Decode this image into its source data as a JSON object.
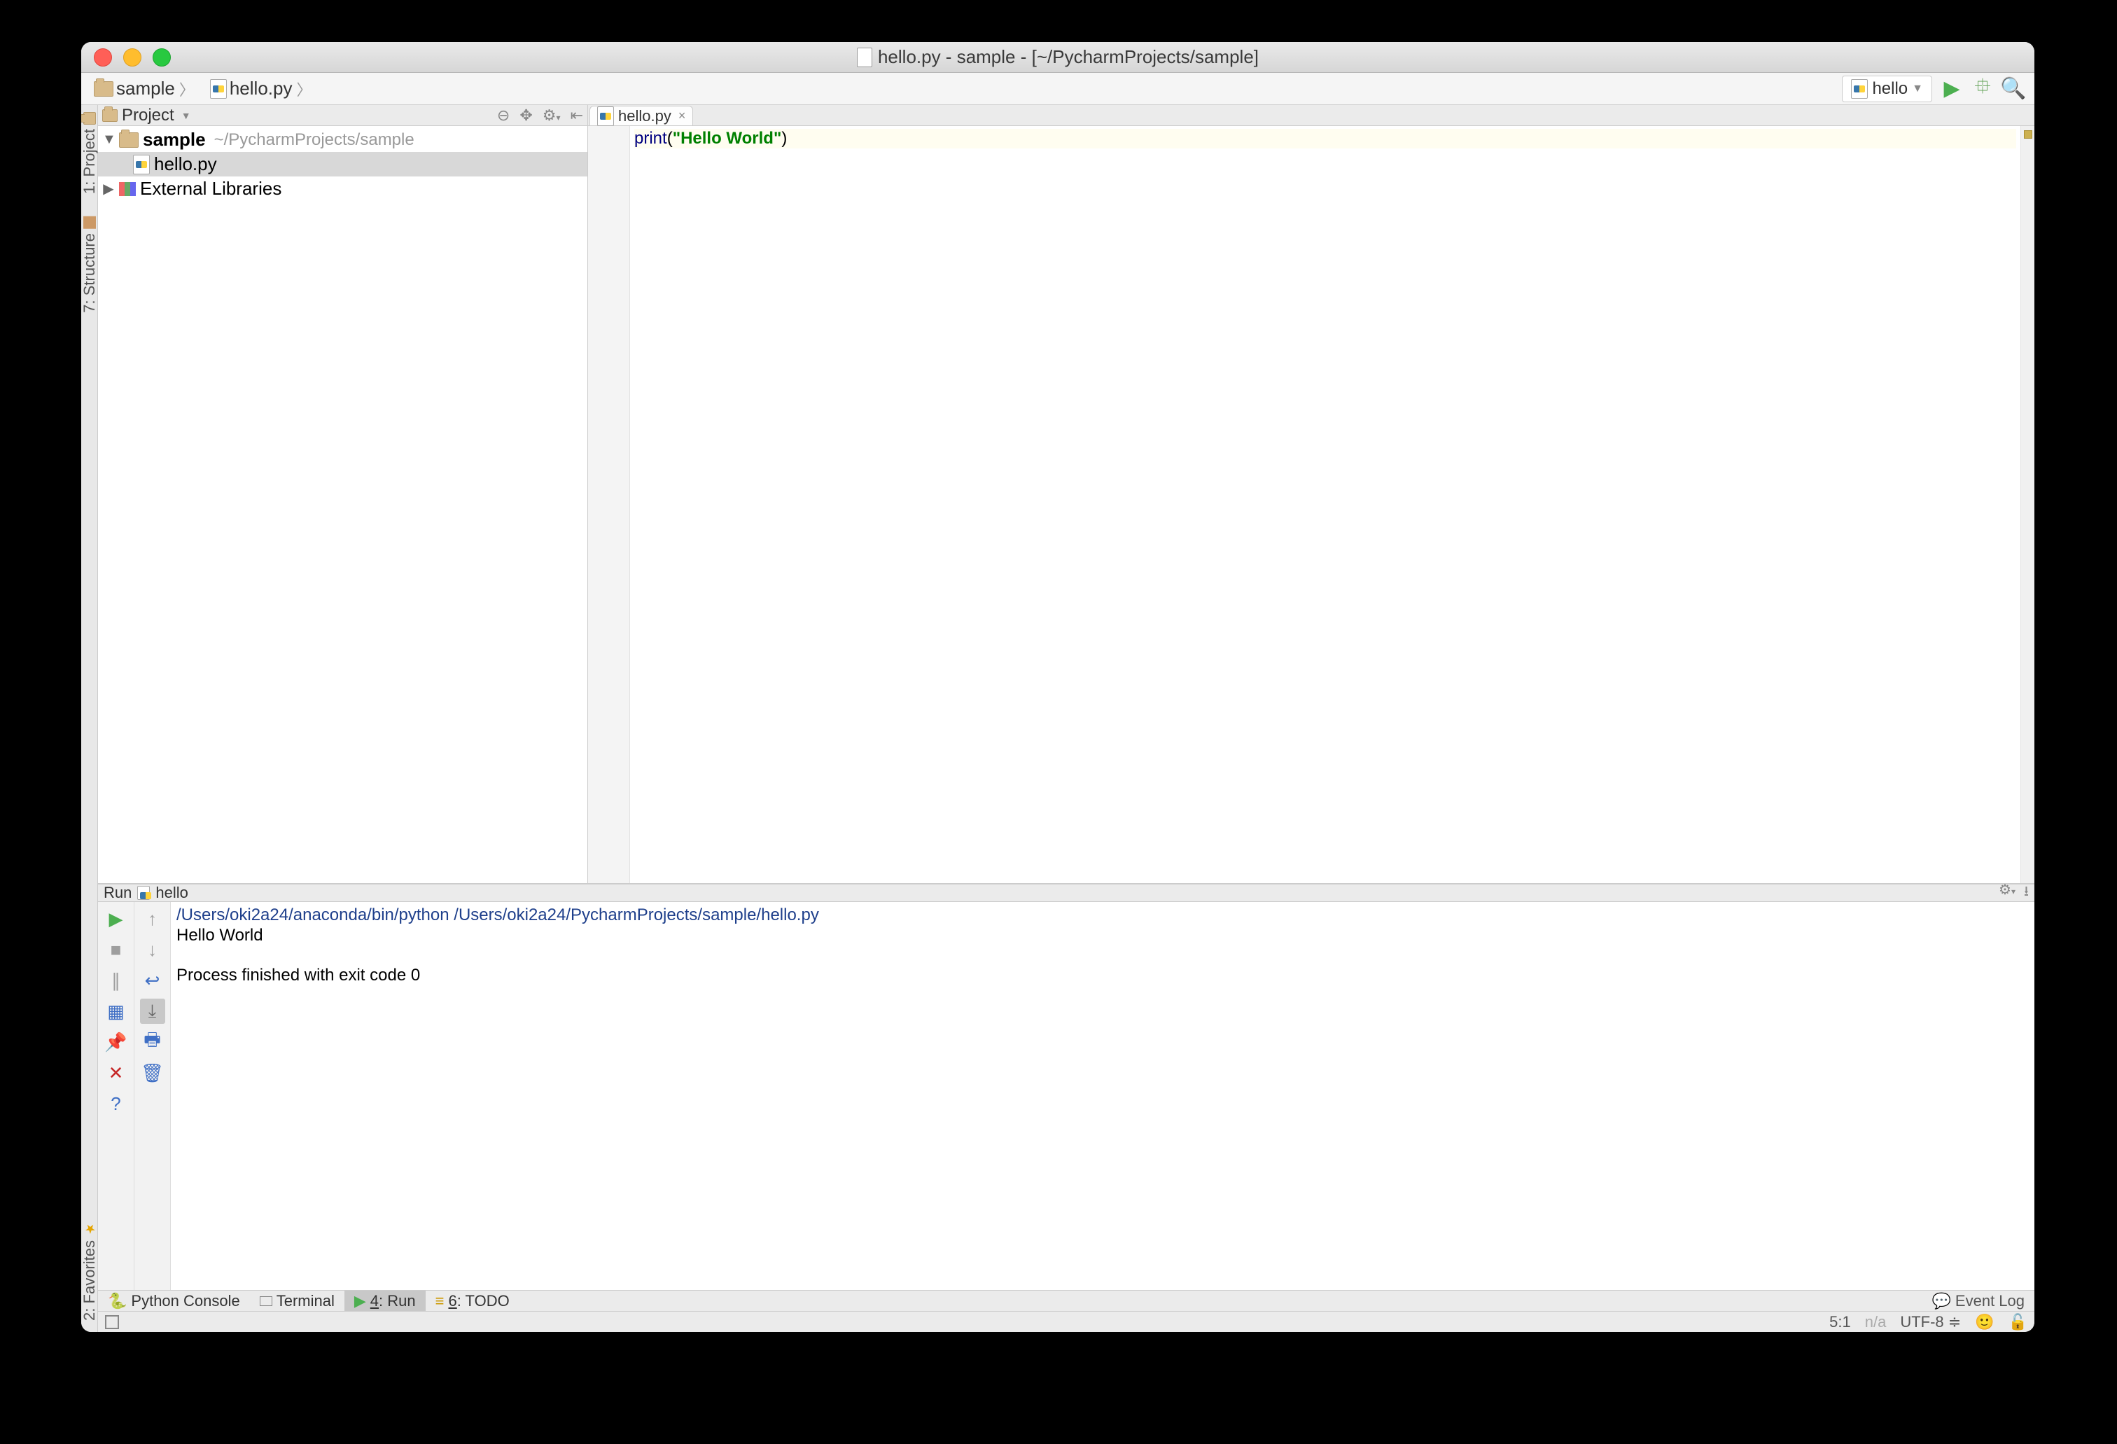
{
  "window_title": "hello.py - sample - [~/PycharmProjects/sample]",
  "breadcrumb": [
    {
      "label": "sample",
      "type": "folder"
    },
    {
      "label": "hello.py",
      "type": "py"
    }
  ],
  "run_config": {
    "name": "hello"
  },
  "left_tabs": [
    {
      "label": "1: Project",
      "key": "project"
    },
    {
      "label": "7: Structure",
      "key": "structure"
    }
  ],
  "fav_tab": {
    "label": "2: Favorites"
  },
  "project_panel": {
    "title": "Project",
    "tree": {
      "root": {
        "name": "sample",
        "path": "~/PycharmProjects/sample"
      },
      "file": {
        "name": "hello.py"
      },
      "libs": {
        "name": "External Libraries"
      }
    }
  },
  "editor": {
    "tab_name": "hello.py",
    "code": {
      "kw": "print",
      "paren_open": "(",
      "str": "\"Hello World\"",
      "paren_close": ")"
    }
  },
  "run_panel": {
    "title_prefix": "Run",
    "title_conf": "hello",
    "command": "/Users/oki2a24/anaconda/bin/python /Users/oki2a24/PycharmProjects/sample/hello.py",
    "output": "Hello World",
    "finished": "Process finished with exit code 0"
  },
  "bottom_tabs": {
    "python_console": "Python Console",
    "terminal": "Terminal",
    "run_prefix": "4",
    "run_label": ": Run",
    "todo_prefix": "6",
    "todo_label": ": TODO",
    "event_log": "Event Log"
  },
  "status": {
    "cursor": "5:1",
    "na": "n/a",
    "encoding": "UTF-8"
  }
}
